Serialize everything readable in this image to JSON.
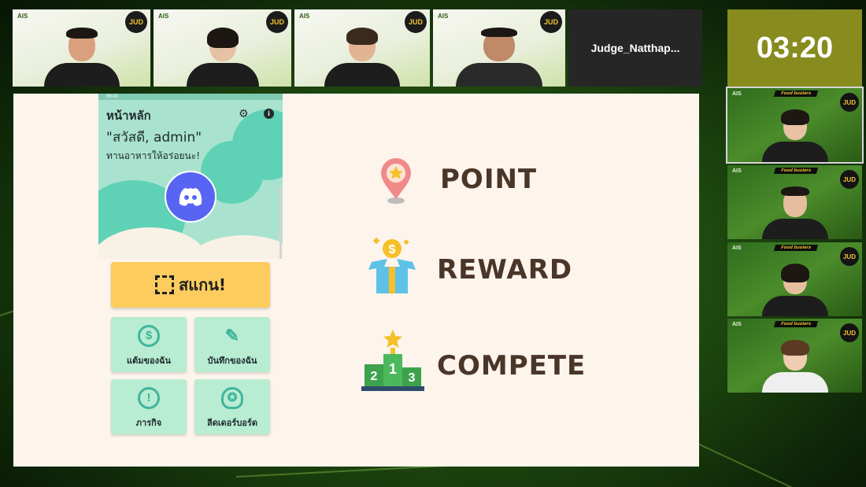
{
  "participants": [
    {
      "badge": "JUD",
      "brand": "AIS"
    },
    {
      "badge": "JUD",
      "brand": "AIS"
    },
    {
      "badge": "JUD",
      "brand": "AIS"
    },
    {
      "badge": "JUD",
      "brand": "AIS"
    }
  ],
  "judge_tile": {
    "name": "Judge_Natthap..."
  },
  "timer": {
    "value": "03:20"
  },
  "side_tiles": [
    {
      "brand": "AIS",
      "team": "Food busters",
      "badge": "JUD"
    },
    {
      "brand": "AIS",
      "team": "Food busters",
      "badge": "JUD"
    },
    {
      "brand": "AIS",
      "team": "Food busters",
      "badge": "JUD"
    },
    {
      "brand": "AIS",
      "team": "Food busters",
      "badge": "JUD"
    }
  ],
  "phone": {
    "status": "06:41",
    "title": "หน้าหลัก",
    "greeting": "\"สวัสดี, admin\"",
    "tagline": "ทานอาหารให้อร่อยนะ!",
    "scan_label": "สแกน!",
    "menu": [
      {
        "label": "แต้มของฉัน",
        "icon": "coin-icon"
      },
      {
        "label": "บันทึกของฉัน",
        "icon": "pencil-icon"
      },
      {
        "label": "ภารกิจ",
        "icon": "alert-icon"
      },
      {
        "label": "ลีดเดอร์บอร์ด",
        "icon": "medal-icon"
      }
    ]
  },
  "features": [
    {
      "label": "POINT",
      "icon": "location-star-icon"
    },
    {
      "label": "REWARD",
      "icon": "gift-box-icon"
    },
    {
      "label": "COMPETE",
      "icon": "podium-icon"
    }
  ],
  "colors": {
    "timer": "#888b1e",
    "share_bg": "#fdf4ec",
    "scan": "#fccc5f",
    "card": "#b8ecd3",
    "text_brown": "#4a3628"
  }
}
